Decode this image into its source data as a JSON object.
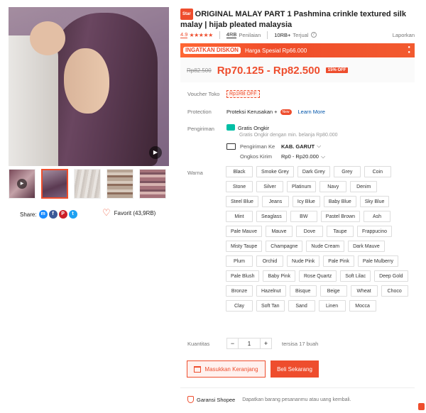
{
  "product": {
    "star_badge": "Star",
    "title": "ORIGINAL MALAY PART 1 Pashmina crinkle textured silk malay | hijab pleated malaysia"
  },
  "rating": {
    "score": "4.9",
    "stars": "★★★★★",
    "reviews_count": "4RB",
    "reviews_label": "Penilaian",
    "sold_count": "10RB+",
    "sold_label": "Terjual",
    "report_label": "Laporkan"
  },
  "flash": {
    "logo_text": "INGATKAN DISKON",
    "text": "Harga Spesial Rp66.000"
  },
  "price": {
    "old": "Rp82.500",
    "current": "Rp70.125 - Rp82.500",
    "discount": "15% OFF"
  },
  "voucher": {
    "label": "Voucher Toko",
    "value": "Rp1RB OFF"
  },
  "protection": {
    "label": "Protection",
    "value": "Proteksi Kerusakan +",
    "new_badge": "New",
    "learn_more": "Learn More"
  },
  "shipping": {
    "label": "Pengiriman",
    "free_title": "Gratis Ongkir",
    "free_sub": "Gratis Ongkir dengan min. belanja Rp80.000",
    "to_label": "Pengiriman Ke",
    "to_value": "KAB. GARUT",
    "cost_label": "Ongkos Kirim",
    "cost_value": "Rp0 - Rp20.000"
  },
  "variants": {
    "label": "Warna",
    "options": [
      "Black",
      "Smoke Grey",
      "Dark Grey",
      "Grey",
      "Coin",
      "Stone",
      "Silver",
      "Platinum",
      "Navy",
      "Denim",
      "Steel Blue",
      "Jeans",
      "Icy Blue",
      "Baby Blue",
      "Sky Blue",
      "Mint",
      "Seaglass",
      "BW",
      "Pastel Brown",
      "Ash",
      "Pale Mauve",
      "Mauve",
      "Dove",
      "Taupe",
      "Frappucino",
      "Misty Taupe",
      "Champagne",
      "Nude Cream",
      "Dark Mauve",
      "Plum",
      "Orchid",
      "Nude Pink",
      "Pale Pink",
      "Pale Mulberry",
      "Pale Blush",
      "Baby Pink",
      "Rose Quartz",
      "Soft Lilac",
      "Deep Gold",
      "Bronze",
      "Hazelnut",
      "Bisque",
      "Beige",
      "Wheat",
      "Choco",
      "Clay",
      "Soft Tan",
      "Sand",
      "Linen",
      "Mocca"
    ]
  },
  "quantity": {
    "label": "Kuantitas",
    "value": "1",
    "minus": "−",
    "plus": "+",
    "stock": "tersisa 17 buah"
  },
  "actions": {
    "add_to_cart": "Masukkan Keranjang",
    "buy_now": "Beli Sekarang"
  },
  "guarantee": {
    "title": "Garansi Shopee",
    "subtitle": "Dapatkan barang pesananmu atau uang kembali."
  },
  "share": {
    "label": "Share:",
    "messenger": "m",
    "facebook": "f",
    "pinterest": "P",
    "twitter": "t"
  },
  "favorite": {
    "label": "Favorit (43,9RB)"
  },
  "gallery": {
    "play_glyph": "▶"
  },
  "colors": {
    "accent": "#ee4d2d",
    "link": "#0055aa",
    "free_ship": "#00bfa5"
  }
}
